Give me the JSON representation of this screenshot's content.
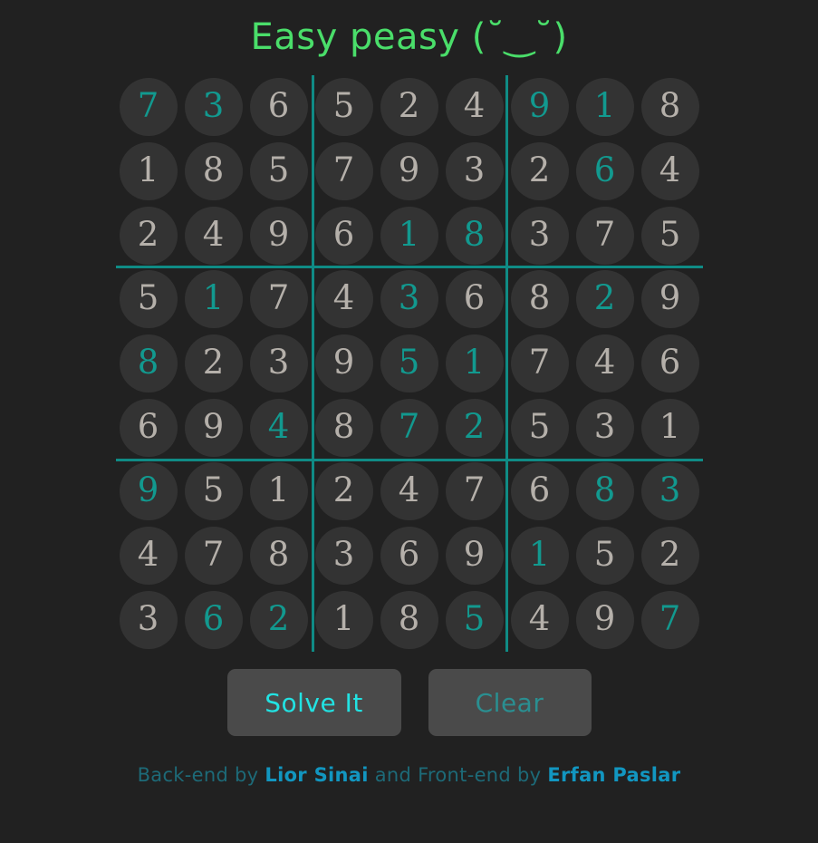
{
  "app": {
    "title": "Easy peasy (˘‿˘)",
    "background_color": "#212121",
    "title_color": "#4ade6a"
  },
  "board": {
    "accent_line_color": "#0f8b85",
    "cell_background_color": "#333333",
    "given_color": "#b5b0aa",
    "solved_color": "#12998f",
    "rows": 9,
    "columns": 9,
    "cells": [
      [
        {
          "value": "7",
          "state": "solved"
        },
        {
          "value": "3",
          "state": "solved"
        },
        {
          "value": "6",
          "state": "given"
        },
        {
          "value": "5",
          "state": "given"
        },
        {
          "value": "2",
          "state": "given"
        },
        {
          "value": "4",
          "state": "given"
        },
        {
          "value": "9",
          "state": "solved"
        },
        {
          "value": "1",
          "state": "solved"
        },
        {
          "value": "8",
          "state": "given"
        }
      ],
      [
        {
          "value": "1",
          "state": "given"
        },
        {
          "value": "8",
          "state": "given"
        },
        {
          "value": "5",
          "state": "given"
        },
        {
          "value": "7",
          "state": "given"
        },
        {
          "value": "9",
          "state": "given"
        },
        {
          "value": "3",
          "state": "given"
        },
        {
          "value": "2",
          "state": "given"
        },
        {
          "value": "6",
          "state": "solved"
        },
        {
          "value": "4",
          "state": "given"
        }
      ],
      [
        {
          "value": "2",
          "state": "given"
        },
        {
          "value": "4",
          "state": "given"
        },
        {
          "value": "9",
          "state": "given"
        },
        {
          "value": "6",
          "state": "given"
        },
        {
          "value": "1",
          "state": "solved"
        },
        {
          "value": "8",
          "state": "solved"
        },
        {
          "value": "3",
          "state": "given"
        },
        {
          "value": "7",
          "state": "given"
        },
        {
          "value": "5",
          "state": "given"
        }
      ],
      [
        {
          "value": "5",
          "state": "given"
        },
        {
          "value": "1",
          "state": "solved"
        },
        {
          "value": "7",
          "state": "given"
        },
        {
          "value": "4",
          "state": "given"
        },
        {
          "value": "3",
          "state": "solved"
        },
        {
          "value": "6",
          "state": "given"
        },
        {
          "value": "8",
          "state": "given"
        },
        {
          "value": "2",
          "state": "solved"
        },
        {
          "value": "9",
          "state": "given"
        }
      ],
      [
        {
          "value": "8",
          "state": "solved"
        },
        {
          "value": "2",
          "state": "given"
        },
        {
          "value": "3",
          "state": "given"
        },
        {
          "value": "9",
          "state": "given"
        },
        {
          "value": "5",
          "state": "solved"
        },
        {
          "value": "1",
          "state": "solved"
        },
        {
          "value": "7",
          "state": "given"
        },
        {
          "value": "4",
          "state": "given"
        },
        {
          "value": "6",
          "state": "given"
        }
      ],
      [
        {
          "value": "6",
          "state": "given"
        },
        {
          "value": "9",
          "state": "given"
        },
        {
          "value": "4",
          "state": "solved"
        },
        {
          "value": "8",
          "state": "given"
        },
        {
          "value": "7",
          "state": "solved"
        },
        {
          "value": "2",
          "state": "solved"
        },
        {
          "value": "5",
          "state": "given"
        },
        {
          "value": "3",
          "state": "given"
        },
        {
          "value": "1",
          "state": "given"
        }
      ],
      [
        {
          "value": "9",
          "state": "solved"
        },
        {
          "value": "5",
          "state": "given"
        },
        {
          "value": "1",
          "state": "given"
        },
        {
          "value": "2",
          "state": "given"
        },
        {
          "value": "4",
          "state": "given"
        },
        {
          "value": "7",
          "state": "given"
        },
        {
          "value": "6",
          "state": "given"
        },
        {
          "value": "8",
          "state": "solved"
        },
        {
          "value": "3",
          "state": "solved"
        }
      ],
      [
        {
          "value": "4",
          "state": "given"
        },
        {
          "value": "7",
          "state": "given"
        },
        {
          "value": "8",
          "state": "given"
        },
        {
          "value": "3",
          "state": "given"
        },
        {
          "value": "6",
          "state": "given"
        },
        {
          "value": "9",
          "state": "given"
        },
        {
          "value": "1",
          "state": "solved"
        },
        {
          "value": "5",
          "state": "given"
        },
        {
          "value": "2",
          "state": "given"
        }
      ],
      [
        {
          "value": "3",
          "state": "given"
        },
        {
          "value": "6",
          "state": "solved"
        },
        {
          "value": "2",
          "state": "solved"
        },
        {
          "value": "1",
          "state": "given"
        },
        {
          "value": "8",
          "state": "given"
        },
        {
          "value": "5",
          "state": "solved"
        },
        {
          "value": "4",
          "state": "given"
        },
        {
          "value": "9",
          "state": "given"
        },
        {
          "value": "7",
          "state": "solved"
        }
      ]
    ]
  },
  "buttons": {
    "solve_label": "Solve It",
    "clear_label": "Clear",
    "solve_color": "#22e2e2",
    "clear_color": "#2a8f91",
    "background_color": "#4a4a4a"
  },
  "footer": {
    "segment_1": "Back-end by ",
    "backend_author": "Lior Sinai",
    "segment_2": " and Front-end by ",
    "frontend_author": "Erfan Paslar",
    "text_color": "#1d6a78",
    "name_color": "#1296c0"
  }
}
